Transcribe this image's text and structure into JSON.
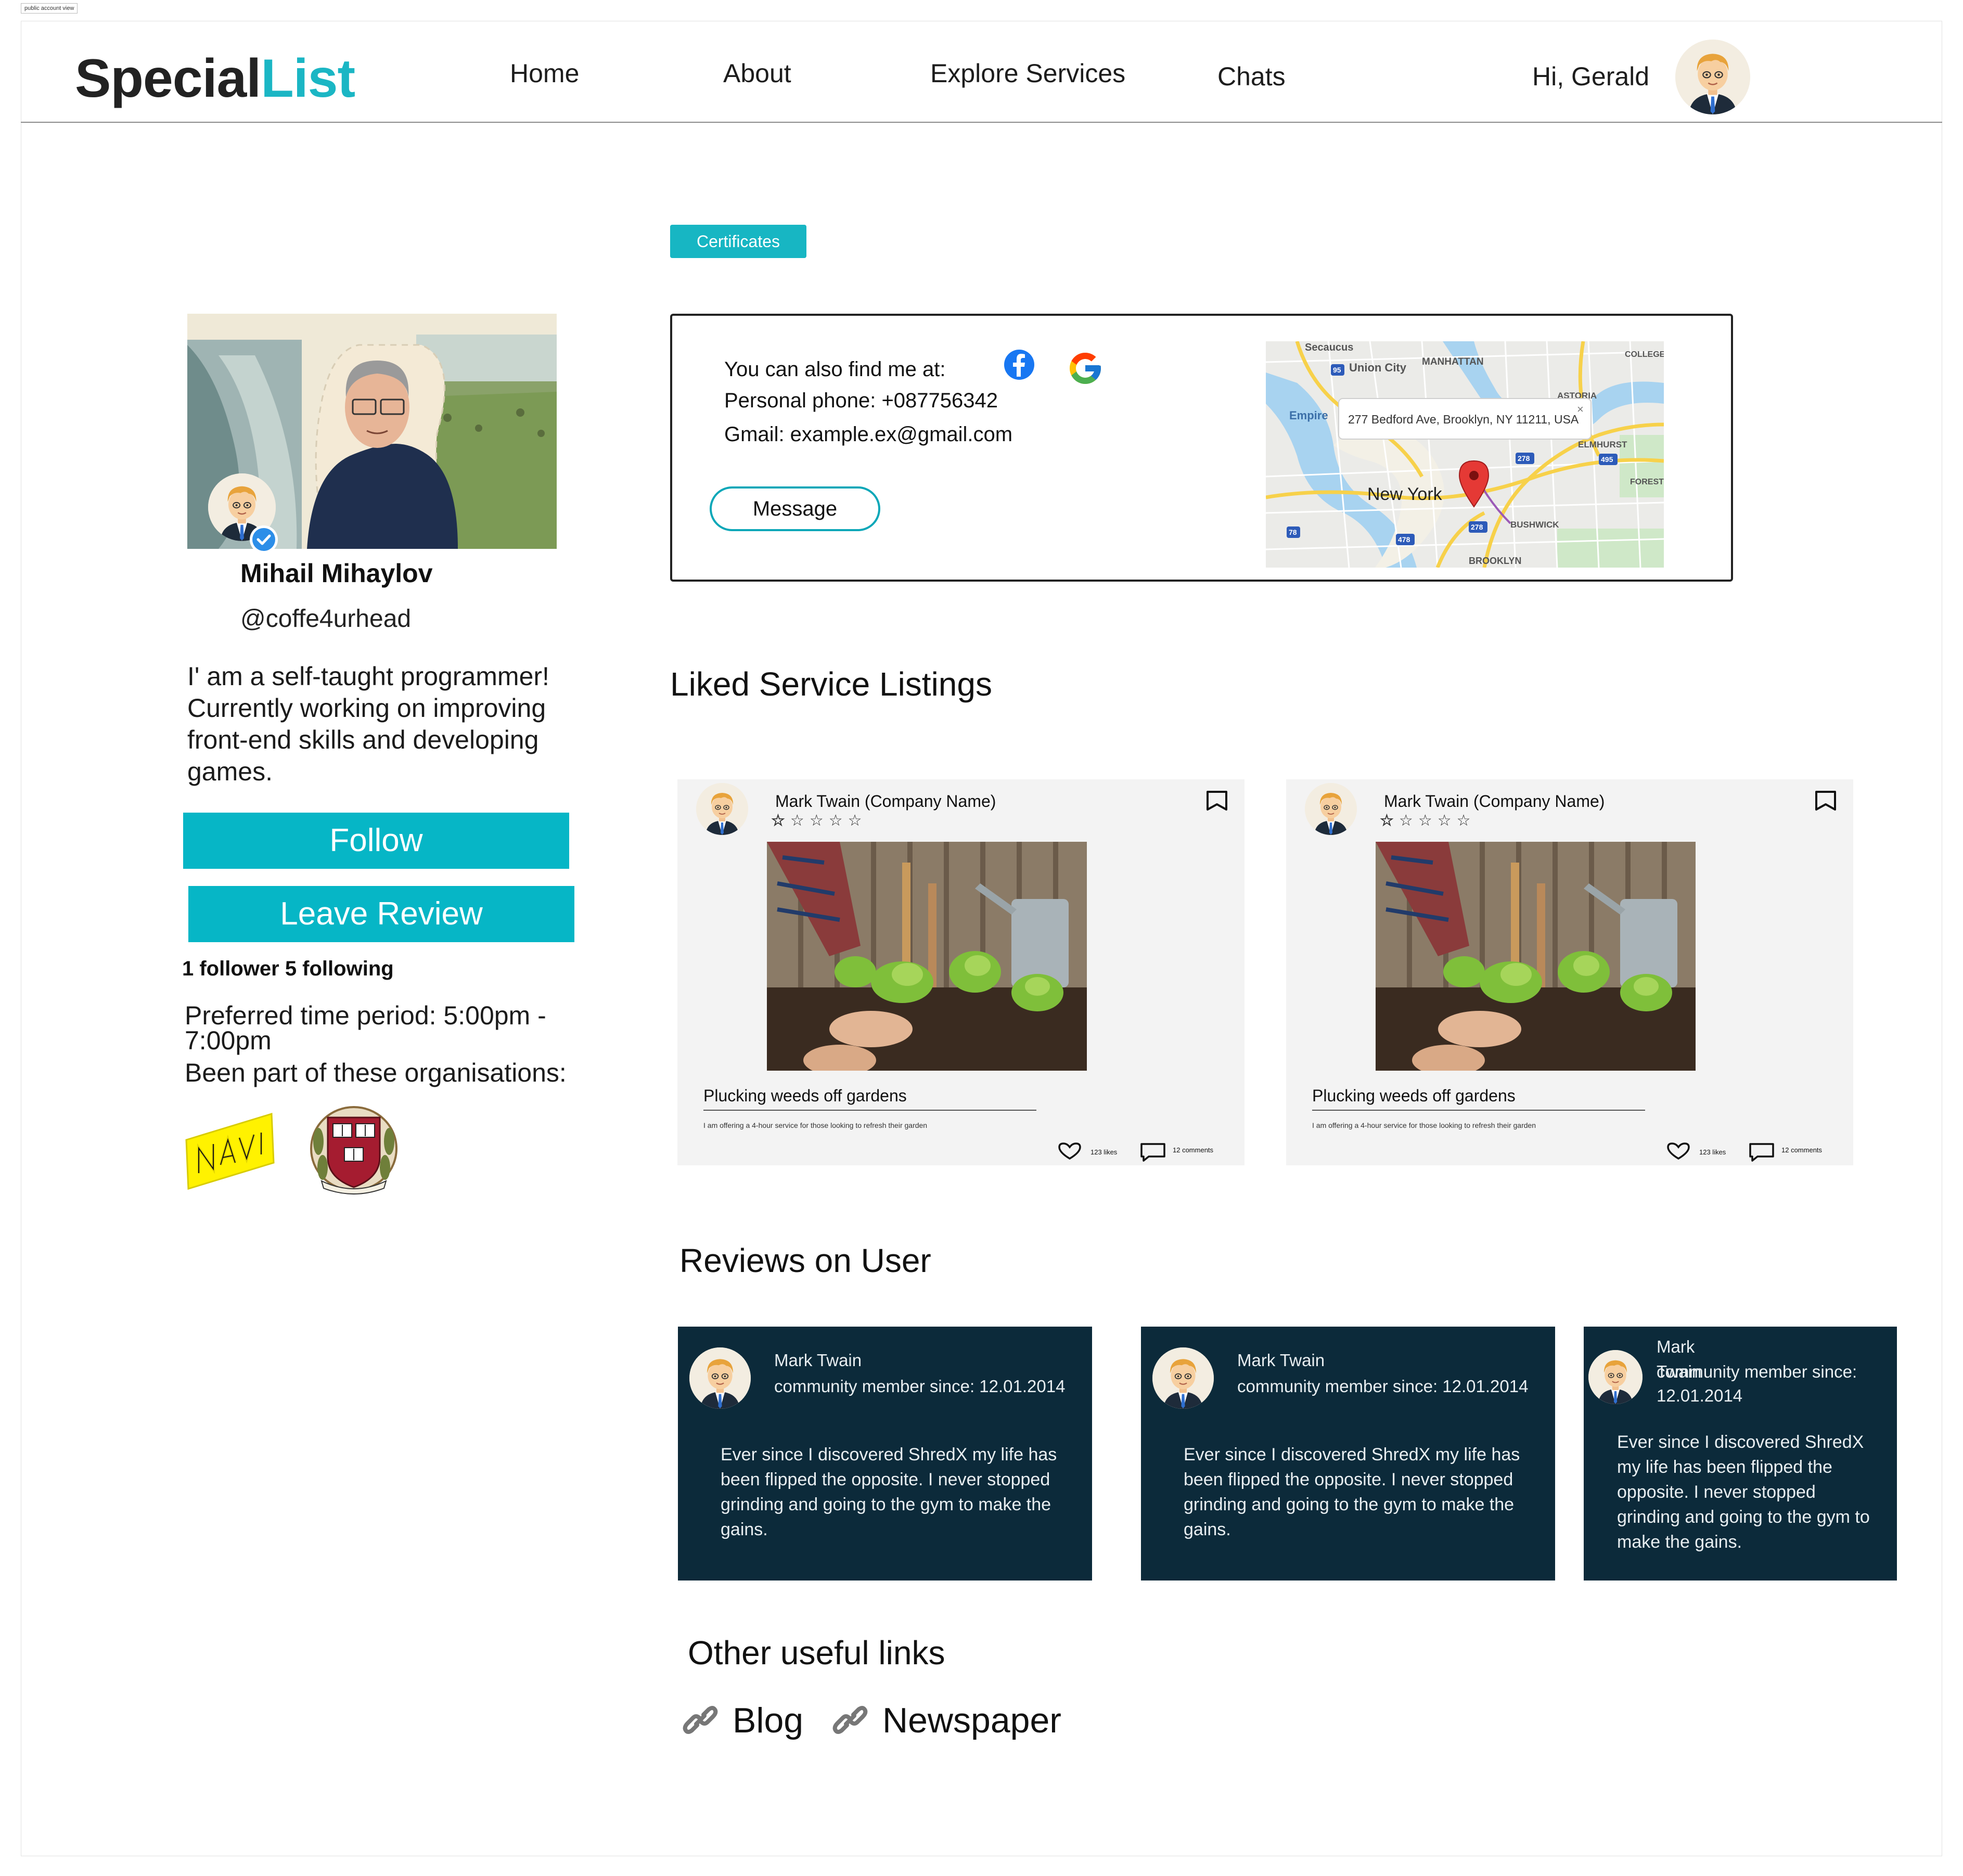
{
  "frame_label": "public account view",
  "header": {
    "logo_part1": "Special",
    "logo_part2": "List",
    "nav": [
      "Home",
      "About",
      "Explore Services",
      "Chats"
    ],
    "greeting": "Hi, Gerald"
  },
  "profile": {
    "name": "Mihail Mihaylov",
    "handle": "@coffe4urhead",
    "bio_lines": [
      "I' am a self-taught programmer!",
      "Currently working on improving",
      "front-end skills and developing",
      "games."
    ],
    "follow_label": "Follow",
    "review_label": "Leave Review",
    "follow_stats": "1 follower 5 following",
    "preferred_line1": "Preferred time period: 5:00pm -",
    "preferred_line2": "7:00pm",
    "organisations_label": "Been part of these organisations:",
    "org_logos": [
      "navi-logo",
      "harvard-logo"
    ]
  },
  "certificates_label": "Certificates",
  "contact": {
    "find_me": "You can also find me at:",
    "phone": "Personal phone: +087756342",
    "gmail": "Gmail: example.ex@gmail.com",
    "message_label": "Message",
    "social_icons": [
      "facebook-icon",
      "google-icon"
    ],
    "map": {
      "address": "277 Bedford Ave, Brooklyn, NY 11211, USA",
      "city_label": "New York",
      "labels": [
        "Secaucus",
        "Union City",
        "MANHATTAN",
        "ASTORIA",
        "Empire",
        "ELMHURST",
        "FOREST HI",
        "BUSHWICK",
        "BROOKLYN",
        "COLLEGE P"
      ],
      "shields": [
        "95",
        "495",
        "278",
        "278",
        "478",
        "78"
      ]
    }
  },
  "liked_title": "Liked Service Listings",
  "listings": [
    {
      "author": "Mark Twain (Company Name)",
      "rating": 1,
      "max_rating": 5,
      "title": "Plucking weeds off gardens",
      "desc": "I am offering a 4-hour service for those looking to refresh their garden",
      "likes": "123 likes",
      "comments": "12 comments"
    },
    {
      "author": "Mark Twain (Company Name)",
      "rating": 1,
      "max_rating": 5,
      "title": "Plucking weeds off gardens",
      "desc": "I am offering a 4-hour service for those looking to refresh their garden",
      "likes": "123 likes",
      "comments": "12 comments"
    }
  ],
  "reviews_title": "Reviews on User",
  "reviews": [
    {
      "name": "Mark Twain",
      "since": "community member since: 12.01.2014",
      "text": [
        "Ever since I discovered ShredX my life has",
        "been flipped the opposite. I never stopped",
        "grinding and going to the gym to make the",
        "gains."
      ]
    },
    {
      "name": "Mark Twain",
      "since": "community member since: 12.01.2014",
      "text": [
        "Ever since I discovered ShredX my life has",
        "been flipped the opposite. I never stopped",
        "grinding and going to the gym to make the",
        "gains."
      ]
    },
    {
      "name_line1": "Mark",
      "name_line2": "Twain",
      "since_line1": "community member since:",
      "since_line2": "12.01.2014",
      "text": [
        "Ever since I discovered ShredX",
        "my life has been flipped the",
        "opposite. I never stopped",
        "grinding and going to the gym to",
        "make the gains."
      ]
    }
  ],
  "links_title": "Other useful links",
  "links": [
    "Blog",
    "Newspaper"
  ],
  "colors": {
    "accent": "#06b6c6",
    "review_bg": "#0c2a3a",
    "logo_accent": "#1bb6c4"
  }
}
